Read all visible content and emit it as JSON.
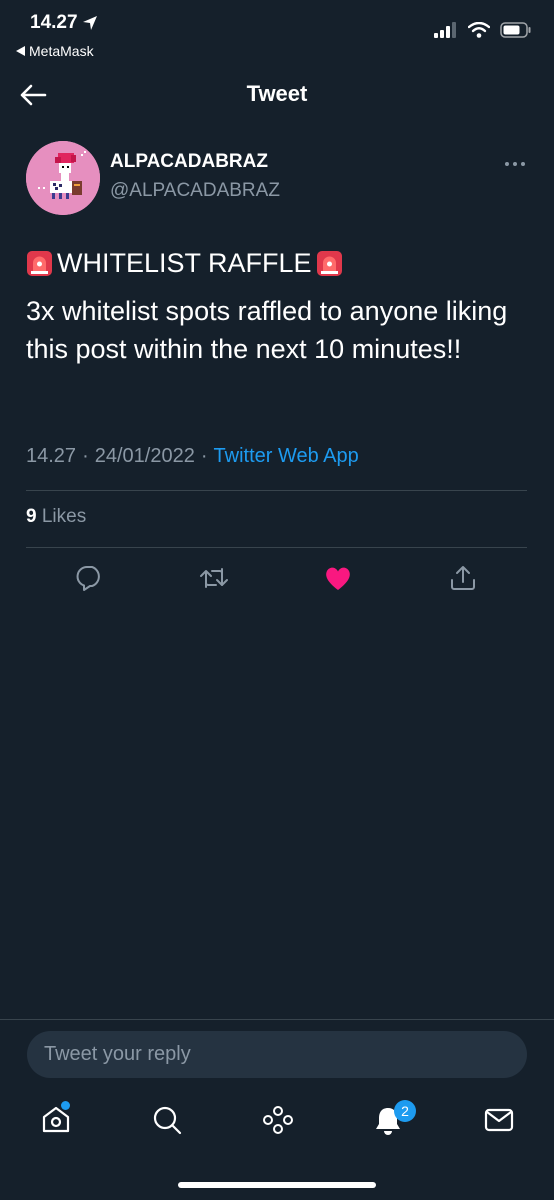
{
  "status_bar": {
    "time": "14.27",
    "back_app": "MetaMask"
  },
  "header": {
    "title": "Tweet"
  },
  "tweet": {
    "display_name": "ALPACADABRAZ",
    "handle": "@ALPACADABRAZ",
    "line1": "WHITELIST RAFFLE",
    "line2": "3x whitelist spots raffled to anyone liking this post within the next 10 minutes!!",
    "time": "14.27",
    "date": "24/01/2022",
    "separator": "·",
    "source": "Twitter Web App",
    "likes_count": "9",
    "likes_label": "Likes",
    "liked": true
  },
  "reply": {
    "placeholder": "Tweet your reply"
  },
  "bottom_nav": {
    "items": [
      "home-icon",
      "search-icon",
      "spaces-icon",
      "notifications-icon",
      "messages-icon"
    ],
    "notifications_badge": "2"
  },
  "colors": {
    "background": "#15202b",
    "accent": "#1d9bf0",
    "like": "#f91880",
    "muted": "#8b98a5"
  }
}
